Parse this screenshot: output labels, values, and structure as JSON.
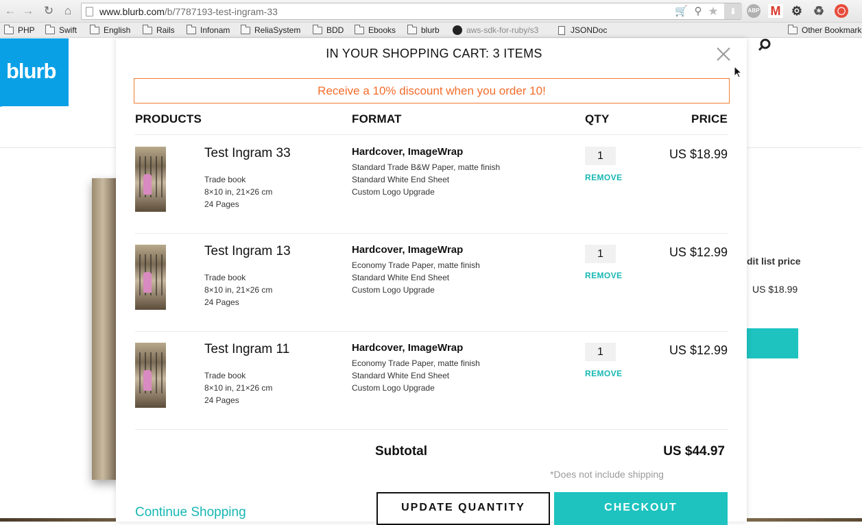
{
  "browser": {
    "url_host": "www.blurb.com",
    "url_path": "/b/7787193-test-ingram-33",
    "bookmarks": [
      {
        "label": "PHP",
        "icon": "folder-icon"
      },
      {
        "label": "Swift",
        "icon": "folder-icon"
      },
      {
        "label": "English",
        "icon": "folder-icon"
      },
      {
        "label": "Rails",
        "icon": "folder-icon"
      },
      {
        "label": "Infonam",
        "icon": "folder-icon"
      },
      {
        "label": "ReliaSystem",
        "icon": "folder-icon"
      },
      {
        "label": "BDD",
        "icon": "folder-icon"
      },
      {
        "label": "Ebooks",
        "icon": "folder-icon"
      },
      {
        "label": "blurb",
        "icon": "folder-icon"
      },
      {
        "label": "aws-sdk-for-ruby/s3",
        "icon": "github-icon"
      },
      {
        "label": "JSONDoc",
        "icon": "document-icon"
      }
    ],
    "other_bookmarks": "Other Bookmarks",
    "extensions": {
      "abp": "ABP"
    }
  },
  "page": {
    "logo_text": "blurb",
    "side_label": "dit list price",
    "side_price": "US $18.99"
  },
  "cart": {
    "title": "IN YOUR SHOPPING CART: 3 ITEMS",
    "discount_banner": "Receive a 10% discount when you order 10!",
    "columns": {
      "products": "PRODUCTS",
      "format": "FORMAT",
      "qty": "QTY",
      "price": "PRICE"
    },
    "items": [
      {
        "title": "Test Ingram 33",
        "meta": [
          "Trade book",
          "8×10 in, 21×26 cm",
          "24 Pages"
        ],
        "format_title": "Hardcover, ImageWrap",
        "format_lines": [
          "Standard Trade B&W Paper, matte finish",
          "Standard White End Sheet",
          "Custom Logo Upgrade"
        ],
        "qty": "1",
        "remove_label": "REMOVE",
        "price": "US $18.99"
      },
      {
        "title": "Test Ingram 13",
        "meta": [
          "Trade book",
          "8×10 in, 21×26 cm",
          "24 Pages"
        ],
        "format_title": "Hardcover, ImageWrap",
        "format_lines": [
          "Economy Trade Paper, matte finish",
          "Standard White End Sheet",
          "Custom Logo Upgrade"
        ],
        "qty": "1",
        "remove_label": "REMOVE",
        "price": "US $12.99"
      },
      {
        "title": "Test Ingram 11",
        "meta": [
          "Trade book",
          "8×10 in, 21×26 cm",
          "24 Pages"
        ],
        "format_title": "Hardcover, ImageWrap",
        "format_lines": [
          "Economy Trade Paper, matte finish",
          "Standard White End Sheet",
          "Custom Logo Upgrade"
        ],
        "qty": "1",
        "remove_label": "REMOVE",
        "price": "US $12.99"
      }
    ],
    "subtotal_label": "Subtotal",
    "subtotal_value": "US $44.97",
    "shipping_note": "*Does not include shipping",
    "continue_label": "Continue Shopping",
    "update_label": "UPDATE QUANTITY",
    "checkout_label": "CHECKOUT"
  },
  "colors": {
    "accent_teal": "#1ec3c0",
    "brand_blue": "#0aa0e6",
    "discount_orange": "#f26c2b"
  }
}
